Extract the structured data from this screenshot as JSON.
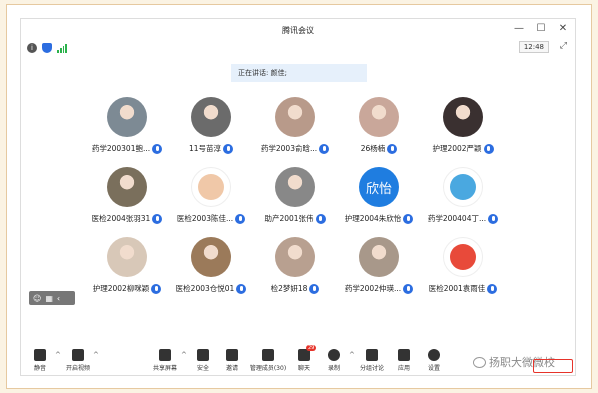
{
  "window": {
    "title": "腾讯会议"
  },
  "window_controls": [
    "—",
    "☐",
    "✕"
  ],
  "status": {
    "time": "12:48"
  },
  "banner": {
    "text": "正在讲话: 颜佳;"
  },
  "participants": [
    {
      "name": "药学200301鲍...",
      "avatar": "photo",
      "color": "#7d8a94"
    },
    {
      "name": "11号苗淳",
      "avatar": "photo",
      "color": "#6b6b6b"
    },
    {
      "name": "药学2003俞晗...",
      "avatar": "photo",
      "color": "#b89a8a"
    },
    {
      "name": "26杨楠",
      "avatar": "photo",
      "color": "#c9a79a"
    },
    {
      "name": "护理2002严颖",
      "avatar": "photo",
      "color": "#3a3030"
    },
    {
      "name": "医检2004张羽31",
      "avatar": "photo",
      "color": "#7a6f5c"
    },
    {
      "name": "医检2003陈佳...",
      "avatar": "cartoon",
      "color": "#f0c8a8"
    },
    {
      "name": "助产2001张伟",
      "avatar": "photo",
      "color": "#888"
    },
    {
      "name": "护理2004朱欣怡",
      "avatar": "text",
      "text": "欣怡",
      "color": "#1f7de0"
    },
    {
      "name": "药学200404丁...",
      "avatar": "cartoon",
      "color": "#4aa8e0"
    },
    {
      "name": "护理2002柳咪颖",
      "avatar": "photo",
      "color": "#d8c8b8"
    },
    {
      "name": "医检2003仓悦01",
      "avatar": "photo",
      "color": "#9b7a5a"
    },
    {
      "name": "检2梦妍18",
      "avatar": "photo",
      "color": "#b8a090"
    },
    {
      "name": "药学2002仲瑛...",
      "avatar": "photo",
      "color": "#a8988a"
    },
    {
      "name": "医检2001袁雨佳",
      "avatar": "cartoon",
      "color": "#e84a3a"
    }
  ],
  "toolbar": {
    "mute": "静音",
    "video": "开启视频",
    "share": "共享屏幕",
    "security": "安全",
    "invite": "邀请",
    "members": "管理成员(30)",
    "chat": "聊天",
    "chat_badge": "29",
    "record": "录制",
    "breakout": "分组讨论",
    "apps": "应用",
    "settings": "设置"
  },
  "watermark": {
    "text": "扬职大微微校"
  }
}
